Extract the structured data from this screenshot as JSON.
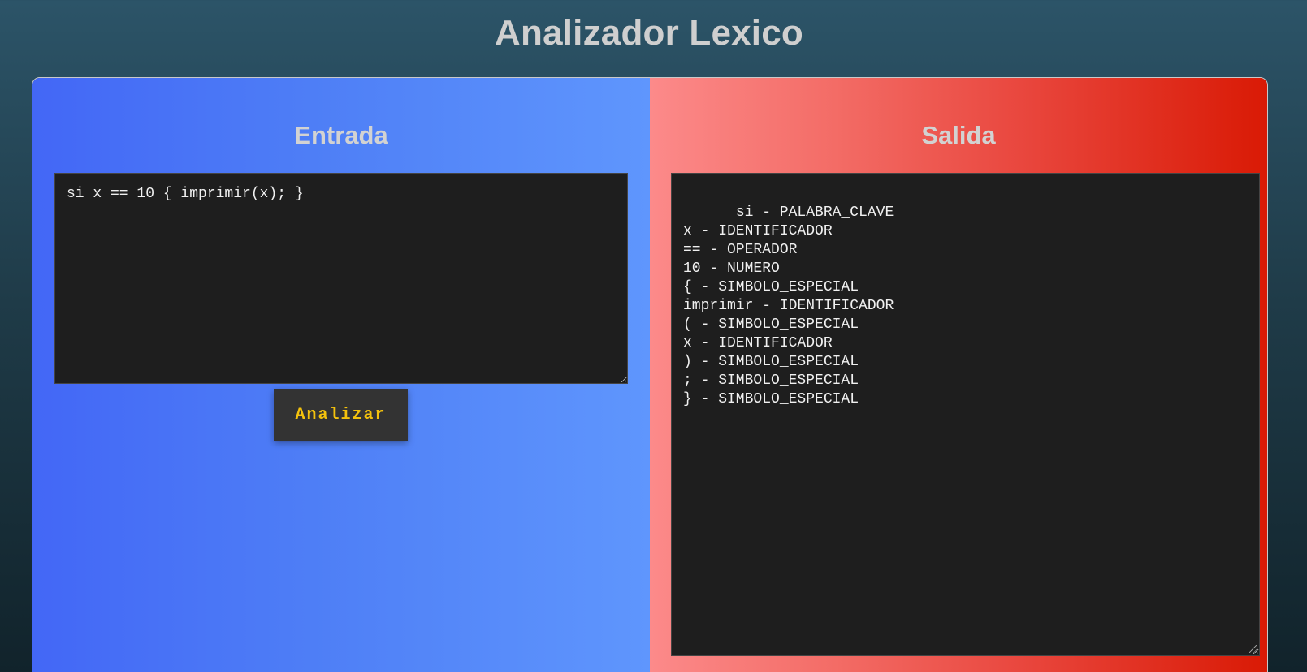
{
  "page": {
    "title": "Analizador Lexico"
  },
  "input_panel": {
    "title": "Entrada",
    "code_value": "si x == 10 { imprimir(x); }",
    "button_label": "Analizar"
  },
  "output_panel": {
    "title": "Salida",
    "tokens_text": "si - PALABRA_CLAVE\nx - IDENTIFICADOR\n== - OPERADOR\n10 - NUMERO\n{ - SIMBOLO_ESPECIAL\nimprimir - IDENTIFICADOR\n( - SIMBOLO_ESPECIAL\nx - IDENTIFICADOR\n) - SIMBOLO_ESPECIAL\n; - SIMBOLO_ESPECIAL\n} - SIMBOLO_ESPECIAL"
  },
  "colors": {
    "input_gradient_start": "#4367f6",
    "input_gradient_end": "#5f96fd",
    "output_gradient_start": "#fc8a8a",
    "output_gradient_end": "#d91a05",
    "code_background": "#1e1e1e",
    "button_background": "#333333",
    "button_text": "#f4c20d"
  }
}
